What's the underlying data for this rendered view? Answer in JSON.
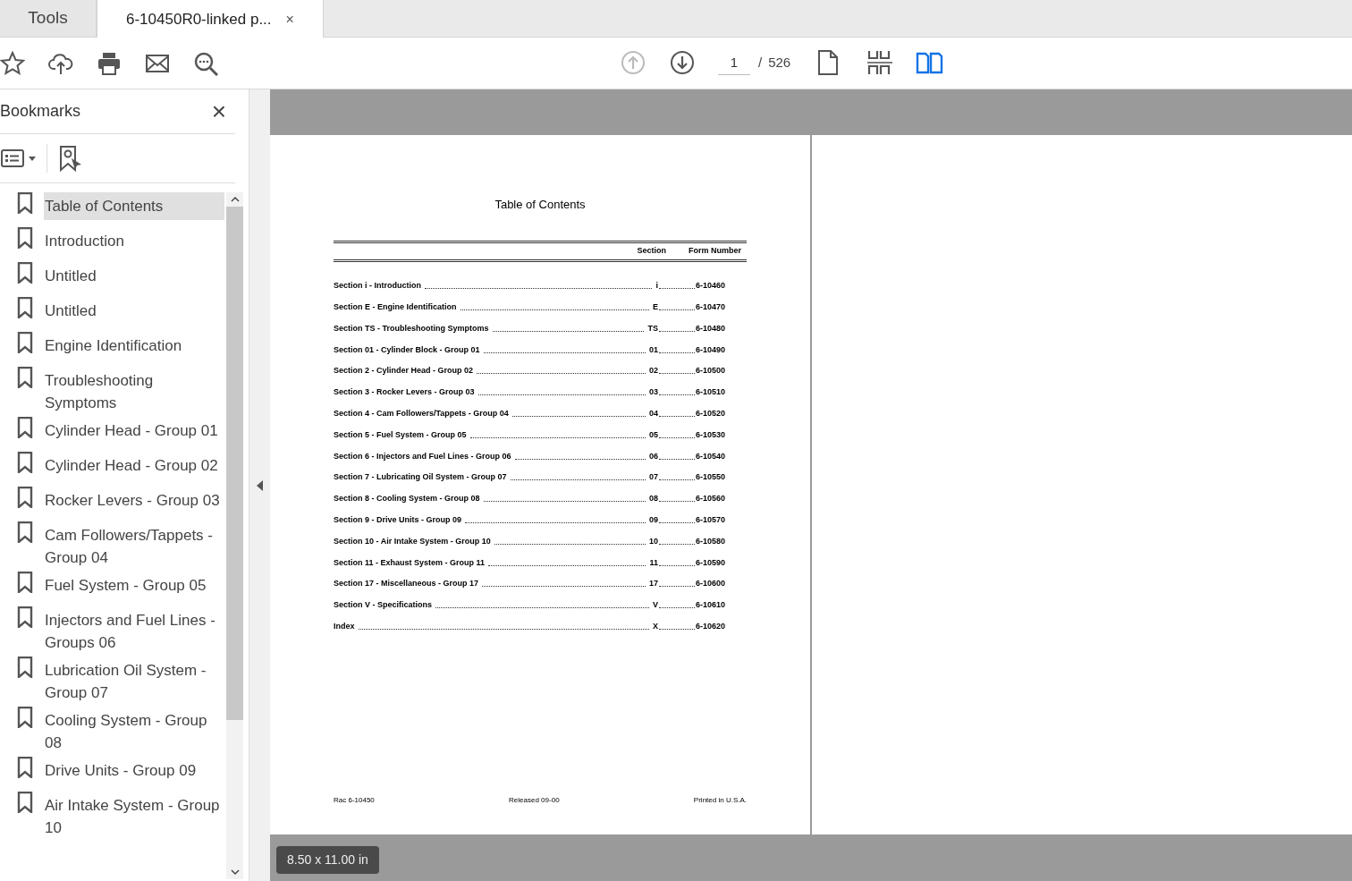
{
  "tabs": [
    {
      "label": "Tools",
      "selected": false
    },
    {
      "label": "6-10450R0-linked p...",
      "selected": true,
      "close": "×"
    }
  ],
  "toolbar": {
    "left_tools": [
      {
        "kind": "star"
      },
      {
        "kind": "upload"
      },
      {
        "kind": "print"
      },
      {
        "kind": "mail"
      },
      {
        "kind": "zoom"
      }
    ],
    "prev_page": {
      "disabled": true
    },
    "next_page": {
      "disabled": false
    },
    "page_number": "1",
    "separator": "/",
    "page_count": "526",
    "view_modes": [
      {
        "kind": "single",
        "selected": false
      },
      {
        "kind": "scroll",
        "selected": false
      },
      {
        "kind": "two",
        "selected": true
      }
    ]
  },
  "bookmarks": {
    "title": "Bookmarks",
    "close": "×",
    "items": [
      {
        "label": "Table of Contents",
        "selected": true
      },
      {
        "label": "Introduction",
        "selected": false
      },
      {
        "label": "Untitled",
        "selected": false
      },
      {
        "label": "Untitled",
        "selected": false
      },
      {
        "label": "Engine Identification",
        "selected": false
      },
      {
        "label": "Troubleshooting Symptoms",
        "selected": false
      },
      {
        "label": "Cylinder Head - Group 01",
        "selected": false
      },
      {
        "label": "Cylinder Head - Group 02",
        "selected": false
      },
      {
        "label": "Rocker Levers - Group 03",
        "selected": false
      },
      {
        "label": "Cam Followers/Tappets - Group 04",
        "selected": false
      },
      {
        "label": "Fuel System - Group 05",
        "selected": false
      },
      {
        "label": "Injectors and Fuel Lines - Groups 06",
        "selected": false
      },
      {
        "label": "Lubrication Oil System - Group 07",
        "selected": false
      },
      {
        "label": "Cooling System - Group 08",
        "selected": false
      },
      {
        "label": "Drive Units - Group 09",
        "selected": false
      },
      {
        "label": "Air Intake System - Group 10",
        "selected": false
      }
    ]
  },
  "document": {
    "title": "Table of Contents",
    "columns": [
      "Section",
      "Form Number"
    ],
    "rows": [
      {
        "title": "Section i - Introduction",
        "section": "i",
        "form": "6-10460"
      },
      {
        "title": "Section E - Engine Identification",
        "section": "E",
        "form": "6-10470"
      },
      {
        "title": "Section TS - Troubleshooting Symptoms",
        "section": "TS",
        "form": "6-10480"
      },
      {
        "title": "Section 01 - Cylinder Block - Group 01",
        "section": "01",
        "form": "6-10490"
      },
      {
        "title": "Section 2 - Cylinder Head - Group 02",
        "section": "02",
        "form": "6-10500"
      },
      {
        "title": "Section 3 - Rocker Levers - Group 03",
        "section": "03",
        "form": "6-10510"
      },
      {
        "title": "Section 4 - Cam Followers/Tappets - Group 04",
        "section": "04",
        "form": "6-10520"
      },
      {
        "title": "Section 5 - Fuel System - Group 05",
        "section": "05",
        "form": "6-10530"
      },
      {
        "title": "Section 6 - Injectors and Fuel Lines - Group 06",
        "section": "06",
        "form": "6-10540"
      },
      {
        "title": "Section 7 - Lubricating Oil System - Group 07",
        "section": "07",
        "form": "6-10550"
      },
      {
        "title": "Section 8 - Cooling System - Group 08",
        "section": "08",
        "form": "6-10560"
      },
      {
        "title": "Section 9 - Drive Units - Group 09",
        "section": "09",
        "form": "6-10570"
      },
      {
        "title": "Section 10 - Air Intake System - Group 10",
        "section": "10",
        "form": "6-10580"
      },
      {
        "title": "Section 11 - Exhaust System - Group 11",
        "section": "11",
        "form": "6-10590"
      },
      {
        "title": "Section 17 - Miscellaneous - Group 17",
        "section": "17",
        "form": "6-10600"
      },
      {
        "title": "Section V - Specifications",
        "section": "V",
        "form": "6-10610"
      },
      {
        "title": "Index",
        "section": "X",
        "form": "6-10620"
      }
    ],
    "footer": [
      "Rac 6-10450",
      "Released 09-00",
      "Printed in U.S.A."
    ]
  },
  "page_size": "8.50 x 11.00 in"
}
